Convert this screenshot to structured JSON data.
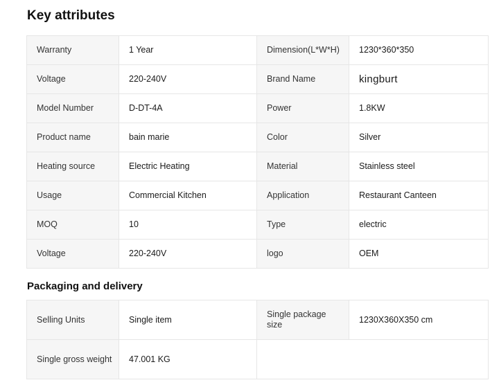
{
  "key_attributes": {
    "title": "Key attributes",
    "rows": [
      [
        {
          "k": "Warranty",
          "v": "1 Year"
        },
        {
          "k": "Dimension(L*W*H)",
          "v": "1230*360*350"
        }
      ],
      [
        {
          "k": "Voltage",
          "v": "220-240V"
        },
        {
          "k": "Brand Name",
          "v": "kingburt"
        }
      ],
      [
        {
          "k": "Model Number",
          "v": "D-DT-4A"
        },
        {
          "k": "Power",
          "v": "1.8KW"
        }
      ],
      [
        {
          "k": "Product name",
          "v": "bain marie"
        },
        {
          "k": "Color",
          "v": "Silver"
        }
      ],
      [
        {
          "k": "Heating source",
          "v": "Electric Heating"
        },
        {
          "k": "Material",
          "v": "Stainless steel"
        }
      ],
      [
        {
          "k": "Usage",
          "v": "Commercial Kitchen"
        },
        {
          "k": "Application",
          "v": "Restaurant Canteen"
        }
      ],
      [
        {
          "k": "MOQ",
          "v": "10"
        },
        {
          "k": "Type",
          "v": "electric"
        }
      ],
      [
        {
          "k": "Voltage",
          "v": "220-240V"
        },
        {
          "k": "logo",
          "v": "OEM"
        }
      ]
    ]
  },
  "packaging": {
    "title": "Packaging and delivery",
    "rows": [
      [
        {
          "k": "Selling Units",
          "v": "Single item"
        },
        {
          "k": "Single package size",
          "v": "1230X360X350 cm"
        }
      ],
      [
        {
          "k": "Single gross weight",
          "v": "47.001 KG"
        }
      ]
    ]
  }
}
